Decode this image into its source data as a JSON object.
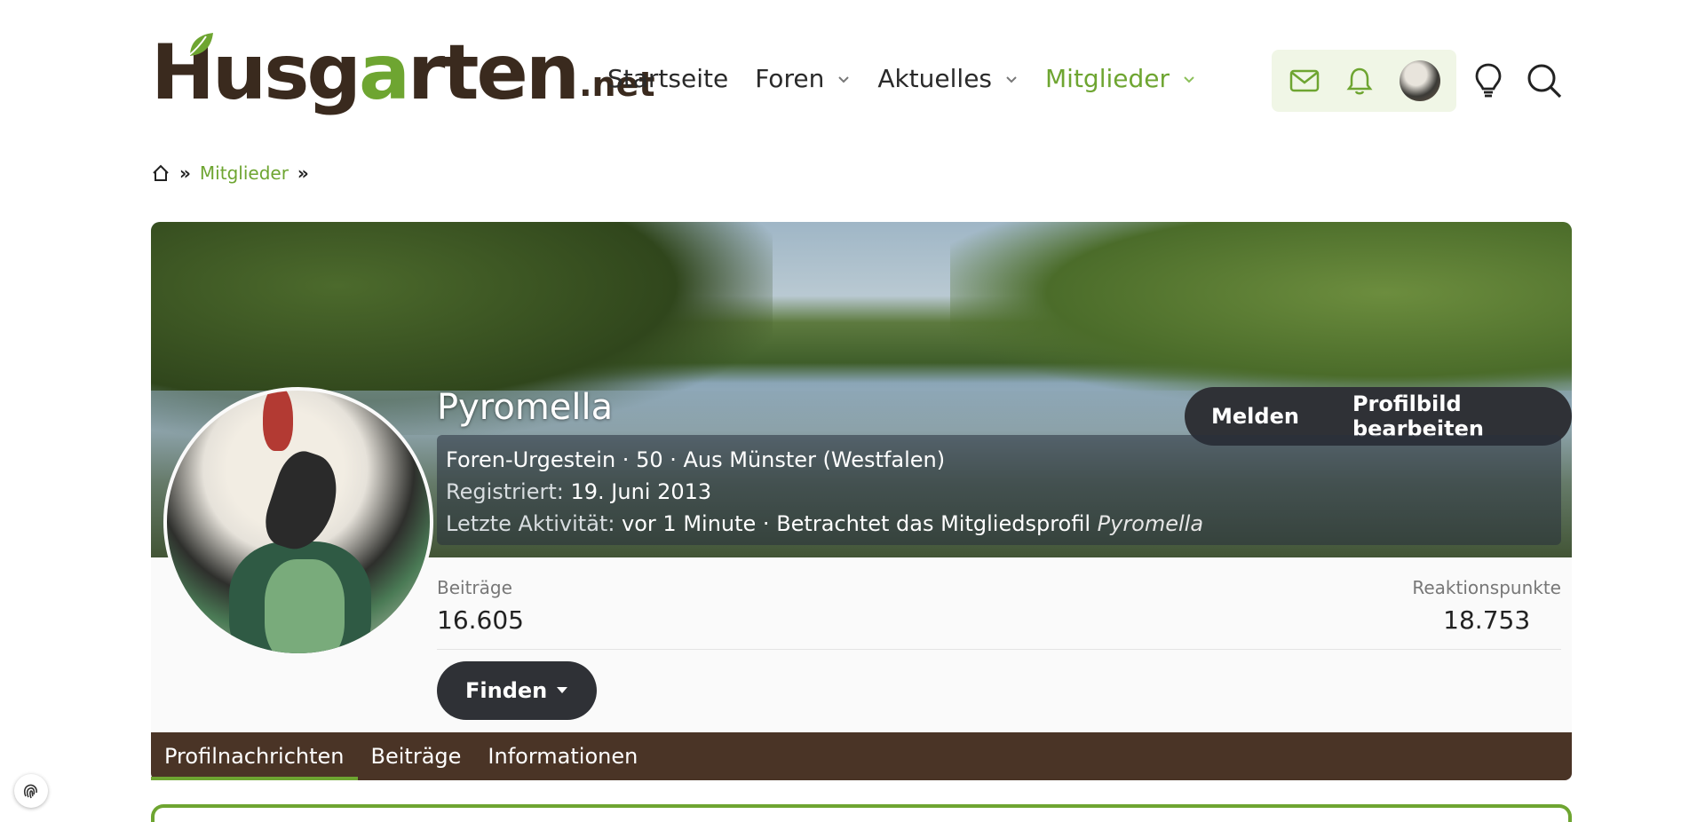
{
  "logo": {
    "main_dark_1": "H",
    "main_dark_2": "usg",
    "main_green": "a",
    "main_rest": "rten",
    "net": ".net"
  },
  "nav": {
    "items": [
      {
        "label": "Startseite",
        "dropdown": false,
        "active": false
      },
      {
        "label": "Foren",
        "dropdown": true,
        "active": false
      },
      {
        "label": "Aktuelles",
        "dropdown": true,
        "active": false
      },
      {
        "label": "Mitglieder",
        "dropdown": true,
        "active": true
      }
    ]
  },
  "header_icons": [
    "mail-icon",
    "bell-icon",
    "user-avatar",
    "lightbulb-icon",
    "search-icon"
  ],
  "breadcrumb": {
    "home_icon": "home-icon",
    "items": [
      "Mitglieder"
    ],
    "sep": "»"
  },
  "profile": {
    "name": "Pyromella",
    "actions": {
      "report": "Melden",
      "edit_banner": "Profilbild bearbeiten"
    },
    "info_line1": "Foren-Urgestein · 50 · Aus Münster (Westfalen)",
    "registered_label": "Registriert:",
    "registered_value": "19. Juni 2013",
    "activity_label": "Letzte Aktivität:",
    "activity_value": "vor 1 Minute · Betrachtet das Mitgliedsprofil",
    "activity_target": "Pyromella",
    "stats": {
      "posts_label": "Beiträge",
      "posts_value": "16.605",
      "reactions_label": "Reaktionspunkte",
      "reactions_value": "18.753"
    },
    "find_button": "Finden"
  },
  "tabs": [
    {
      "label": "Profilnachrichten",
      "active": true
    },
    {
      "label": "Beiträge",
      "active": false
    },
    {
      "label": "Informationen",
      "active": false
    }
  ],
  "colors": {
    "accent": "#6ea531",
    "dark_brown": "#4a3426",
    "button_dark": "#2f3136"
  }
}
